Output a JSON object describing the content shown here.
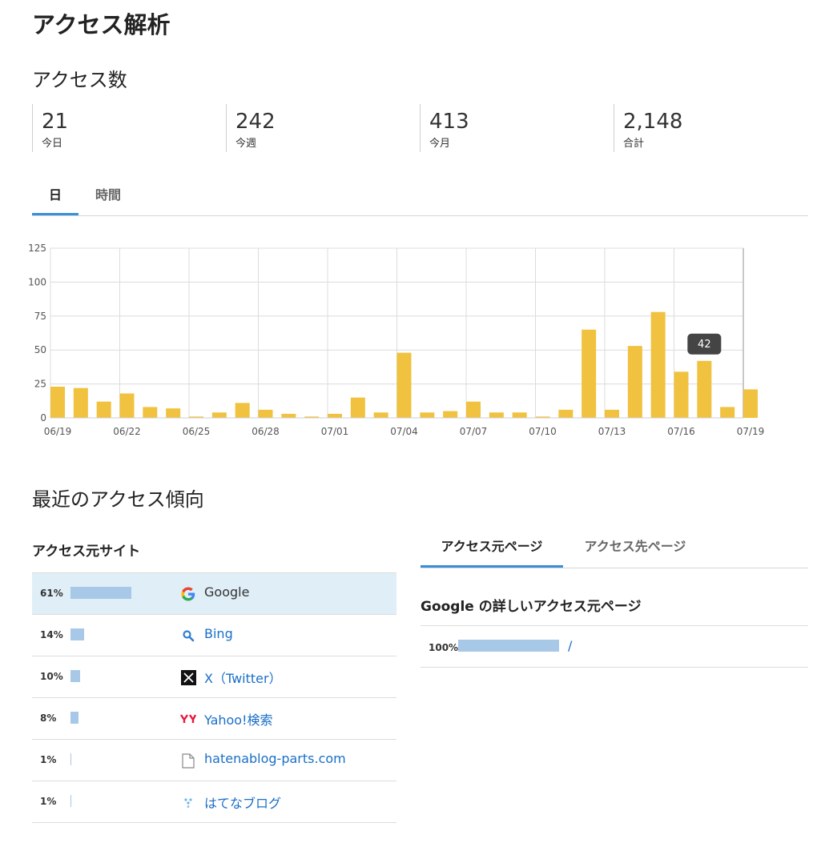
{
  "page": {
    "title": "アクセス解析"
  },
  "access_count": {
    "title": "アクセス数",
    "stats": [
      {
        "value": "21",
        "label": "今日"
      },
      {
        "value": "242",
        "label": "今週"
      },
      {
        "value": "413",
        "label": "今月"
      },
      {
        "value": "2,148",
        "label": "合計"
      }
    ],
    "tabs": [
      {
        "label": "日",
        "active": true
      },
      {
        "label": "時間",
        "active": false
      }
    ]
  },
  "chart_data": {
    "type": "bar",
    "categories": [
      "06/19",
      "06/20",
      "06/21",
      "06/22",
      "06/23",
      "06/24",
      "06/25",
      "06/26",
      "06/27",
      "06/28",
      "06/29",
      "06/30",
      "07/01",
      "07/02",
      "07/03",
      "07/04",
      "07/05",
      "07/06",
      "07/07",
      "07/08",
      "07/09",
      "07/10",
      "07/11",
      "07/12",
      "07/13",
      "07/14",
      "07/15",
      "07/16",
      "07/17",
      "07/18",
      "07/19"
    ],
    "values": [
      23,
      22,
      12,
      18,
      8,
      7,
      1,
      4,
      11,
      6,
      3,
      1,
      3,
      15,
      4,
      48,
      4,
      5,
      12,
      4,
      4,
      1,
      6,
      65,
      6,
      53,
      78,
      34,
      42,
      8,
      21
    ],
    "x_tick_labels": [
      "06/19",
      "06/22",
      "06/25",
      "06/28",
      "07/01",
      "07/04",
      "07/07",
      "07/10",
      "07/13",
      "07/16",
      "07/19"
    ],
    "y_ticks": [
      0,
      25,
      50,
      75,
      100,
      125
    ],
    "ylim": [
      0,
      125
    ],
    "grid": true,
    "bar_color": "#f0c23f",
    "tooltip": {
      "category": "07/17",
      "value": "42"
    }
  },
  "trends": {
    "title": "最近のアクセス傾向",
    "referrers": {
      "title": "アクセス元サイト",
      "items": [
        {
          "percent": "61%",
          "share": 61,
          "name": "Google",
          "icon": "google-icon",
          "selected": true
        },
        {
          "percent": "14%",
          "share": 14,
          "name": "Bing",
          "icon": "bing-search-icon",
          "selected": false
        },
        {
          "percent": "10%",
          "share": 10,
          "name": "X（Twitter）",
          "icon": "x-twitter-icon",
          "selected": false
        },
        {
          "percent": "8%",
          "share": 8,
          "name": "Yahoo!検索",
          "icon": "yahoo-icon",
          "selected": false
        },
        {
          "percent": "1%",
          "share": 1,
          "name": "hatenablog-parts.com",
          "icon": "page-icon",
          "selected": false
        },
        {
          "percent": "1%",
          "share": 1,
          "name": "はてなブログ",
          "icon": "hatena-blog-icon",
          "selected": false
        }
      ]
    },
    "page_tabs": [
      {
        "label": "アクセス元ページ",
        "active": true
      },
      {
        "label": "アクセス先ページ",
        "active": false
      }
    ],
    "detail": {
      "title": "Google の詳しいアクセス元ページ",
      "items": [
        {
          "percent": "100%",
          "share": 100,
          "path": "/"
        }
      ]
    }
  },
  "colors": {
    "accent": "#3a8fd9",
    "bar": "#f0c23f",
    "share_bar": "#a8c8e8",
    "link": "#1a6fc7",
    "selected_row": "#dfeef7"
  }
}
